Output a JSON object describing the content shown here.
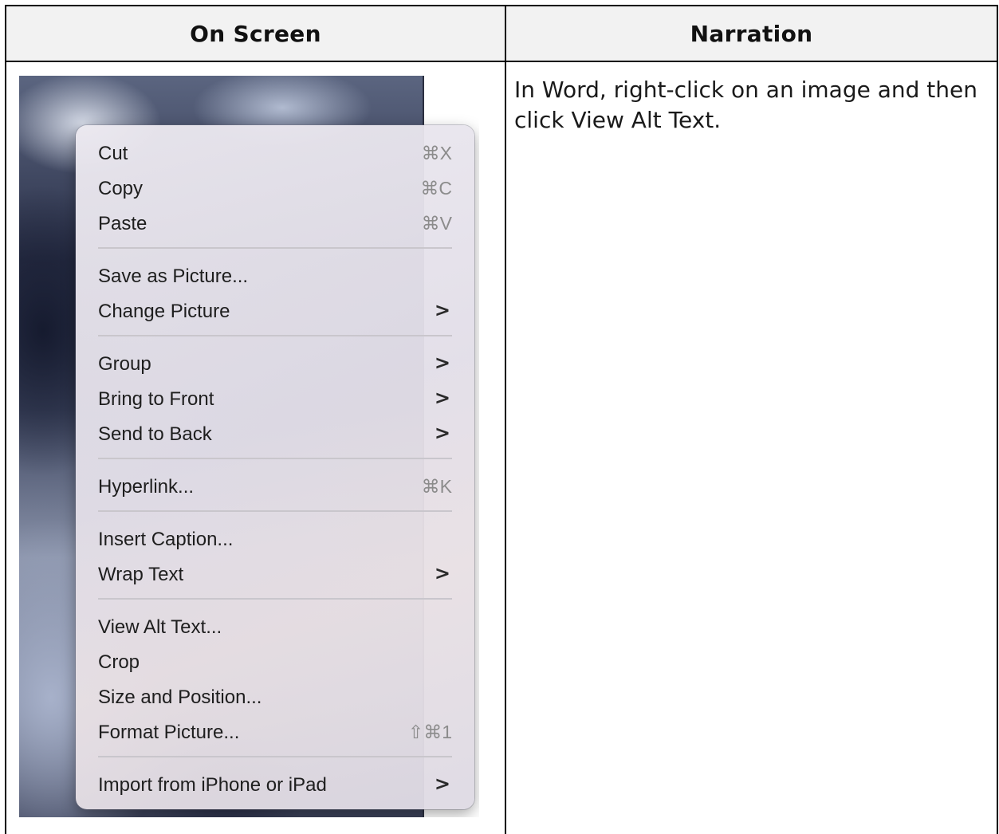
{
  "table": {
    "col_left_header": "On Screen",
    "col_right_header": "Narration",
    "narration_text": "In Word, right-click on an image and then click View Alt Text."
  },
  "context_menu": {
    "items": [
      {
        "label": "Cut",
        "shortcut": "⌘X",
        "submenu": false
      },
      {
        "label": "Copy",
        "shortcut": "⌘C",
        "submenu": false
      },
      {
        "label": "Paste",
        "shortcut": "⌘V",
        "submenu": false
      },
      {
        "label": "Save as Picture...",
        "shortcut": "",
        "submenu": false
      },
      {
        "label": "Change Picture",
        "shortcut": "",
        "submenu": true
      },
      {
        "label": "Group",
        "shortcut": "",
        "submenu": true
      },
      {
        "label": "Bring to Front",
        "shortcut": "",
        "submenu": true
      },
      {
        "label": "Send to Back",
        "shortcut": "",
        "submenu": true
      },
      {
        "label": "Hyperlink...",
        "shortcut": "⌘K",
        "submenu": false
      },
      {
        "label": "Insert Caption...",
        "shortcut": "",
        "submenu": false
      },
      {
        "label": "Wrap Text",
        "shortcut": "",
        "submenu": true
      },
      {
        "label": "View Alt Text...",
        "shortcut": "",
        "submenu": false
      },
      {
        "label": "Crop",
        "shortcut": "",
        "submenu": false
      },
      {
        "label": "Size and Position...",
        "shortcut": "",
        "submenu": false
      },
      {
        "label": "Format Picture...",
        "shortcut": "⇧⌘1",
        "submenu": false
      },
      {
        "label": "Import from iPhone or iPad",
        "shortcut": "",
        "submenu": true
      }
    ],
    "submenu_arrow": ">",
    "icons": {
      "submenu_arrow": "chevron-right-icon"
    }
  }
}
